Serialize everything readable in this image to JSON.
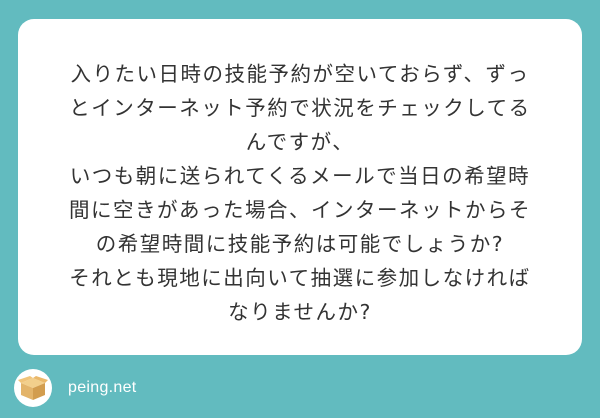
{
  "question": {
    "lines": [
      "入りたい日時の技能予約が空いておらず、ずっ",
      "とインターネット予約で状況をチェックしてる",
      "んですが、",
      "いつも朝に送られてくるメールで当日の希望時",
      "間に空きがあった場合、インターネットからそ",
      "の希望時間に技能予約は可能でしょうか?",
      "それとも現地に出向いて抽選に参加しなければ",
      "なりませんか?"
    ]
  },
  "footer": {
    "logo_icon": "cardboard-box-icon",
    "brand": "peing.net"
  },
  "colors": {
    "background": "#62bbbf",
    "card": "#ffffff",
    "text": "#333333",
    "box": "#e3b46a"
  }
}
